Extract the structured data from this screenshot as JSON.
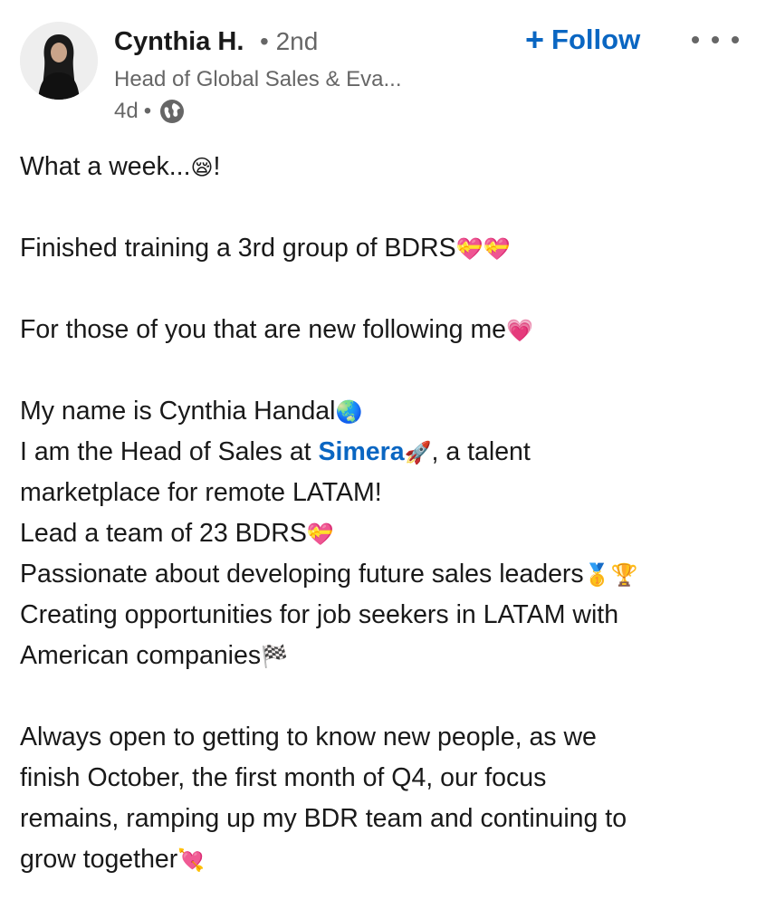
{
  "author": {
    "name": "Cynthia H.",
    "degree": "• 2nd",
    "headline": "Head of Global Sales & Eva...",
    "time": "4d",
    "time_sep": "•",
    "visibility_icon": "globe-icon"
  },
  "actions": {
    "follow_plus": "+",
    "follow_label": "Follow",
    "more_icon": "more-dots-icon"
  },
  "post": {
    "l1": "What a week...",
    "l1_emoji": "😪",
    "l1_end": "!",
    "l2": "Finished training a 3rd group of BDRS",
    "l2_emoji": "💝💝",
    "l3": "For those of you that are new following me",
    "l3_emoji": "💗",
    "l4": "My name is Cynthia Handal",
    "l4_emoji": "🌏",
    "l5_a": "I am the Head of Sales at ",
    "l5_link": "Simera",
    "l5_emoji": "🚀",
    "l5_b": ", a talent",
    "l6": "marketplace for remote LATAM!",
    "l7": "Lead a team of 23 BDRS",
    "l7_emoji": "💝",
    "l8": "Passionate about developing future sales leaders",
    "l8_emoji": "🥇🏆",
    "l9": "Creating opportunities for job seekers in LATAM with",
    "l10": "American companies",
    "l10_emoji": "🏁",
    "l11": "Always open to getting to know new people, as we",
    "l12": "finish October, the first month of Q4, our focus",
    "l13": "remains, ramping up my BDR team and continuing to",
    "l14": "grow together",
    "l14_emoji": "💘"
  },
  "colors": {
    "link": "#0a66c2",
    "text": "#191919",
    "muted": "#666666"
  }
}
